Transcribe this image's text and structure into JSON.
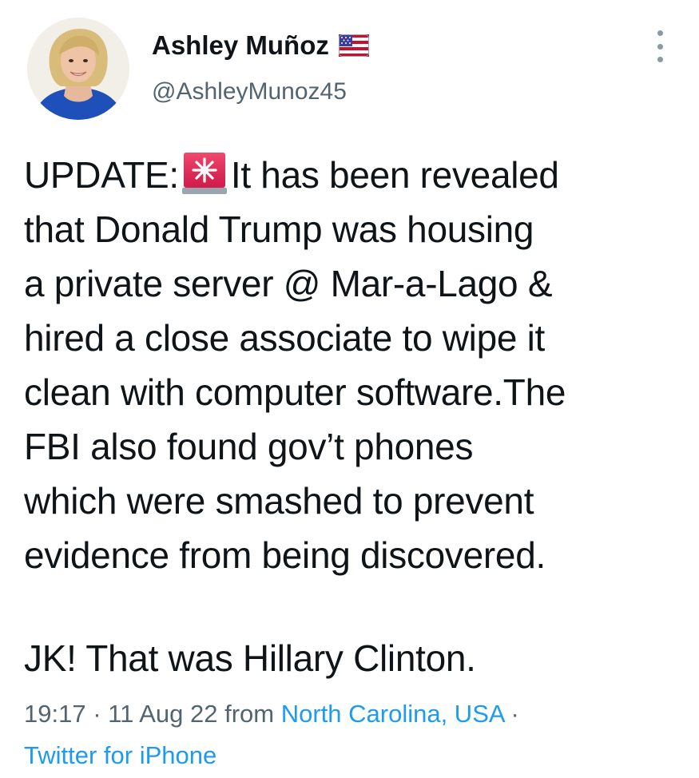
{
  "author": {
    "display_name": "Ashley Muñoz",
    "handle": "@AshleyMunoz45",
    "flag_icon": "us-flag-icon",
    "avatar": "avatar-photo"
  },
  "tweet": {
    "lines": [
      {
        "before": "UPDATE:",
        "icon": "police-siren-icon",
        "after": "It has been revealed"
      },
      {
        "text": "that Donald Trump was housing"
      },
      {
        "text": "a private server @ Mar-a-Lago &"
      },
      {
        "text": "hired a close associate to wipe it"
      },
      {
        "text": "clean with computer software.The"
      },
      {
        "text": "FBI also found gov’t phones"
      },
      {
        "text": "which were smashed to prevent"
      },
      {
        "text": "evidence from being discovered."
      }
    ],
    "punchline": "JK! That was Hillary Clinton."
  },
  "meta": {
    "time": "19:17",
    "sep1": " · ",
    "date": "11 Aug 22",
    "from_label": " from ",
    "location": "North Carolina, USA",
    "sep2": " ·",
    "source": "Twitter for iPhone"
  },
  "colors": {
    "text_primary": "#0f1419",
    "text_secondary": "#536471",
    "link": "#1d9bf0",
    "siren_red": "#e0245e"
  }
}
